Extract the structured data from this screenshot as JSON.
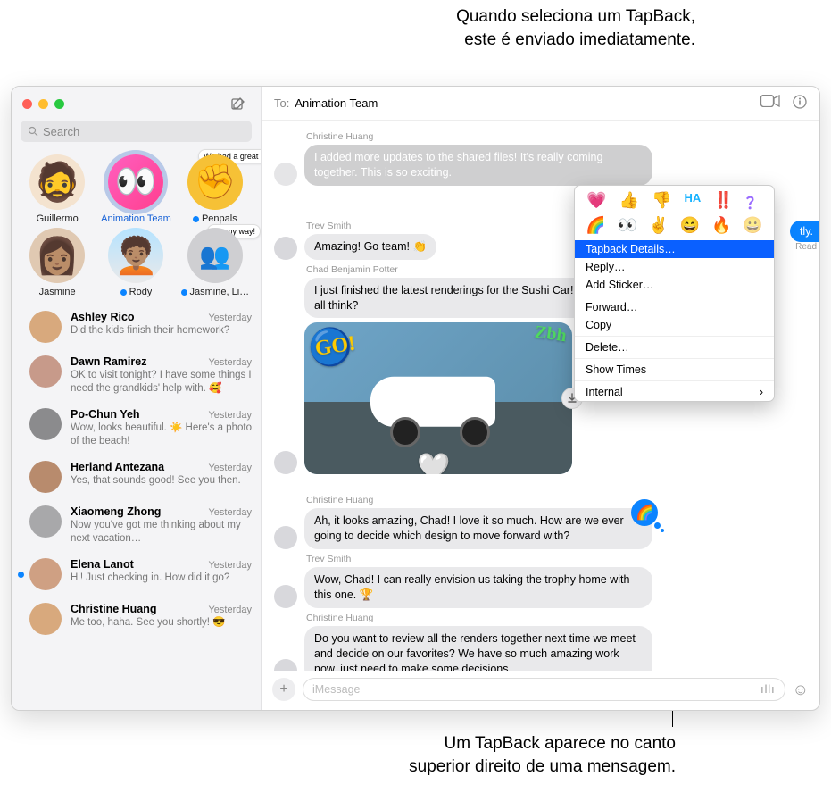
{
  "annotations": {
    "top": "Quando seleciona um TapBack,\neste é enviado imediatamente.",
    "bottom": "Um TapBack aparece no canto\nsuperior direito de uma mensagem."
  },
  "search": {
    "placeholder": "Search"
  },
  "header": {
    "to_label": "To:",
    "to_value": "Animation Team"
  },
  "pins": [
    {
      "name": "Guillermo",
      "selected": false,
      "unread": false,
      "face": "🧔"
    },
    {
      "name": "Animation Team",
      "selected": true,
      "unread": false,
      "face": "👀",
      "bg": "#ff4fa0"
    },
    {
      "name": "Penpals",
      "selected": false,
      "unread": true,
      "face": "✊",
      "preview": "We had a great time. Home with…",
      "bg": "#f6c136"
    },
    {
      "name": "Jasmine",
      "selected": false,
      "unread": false,
      "face": "👩🏽"
    },
    {
      "name": "Rody",
      "selected": false,
      "unread": true,
      "face": "🧑🏽‍🦱",
      "bg": "#e9e9ea"
    },
    {
      "name": "Jasmine, Li…",
      "selected": false,
      "unread": true,
      "face": "👥",
      "preview": "On my way!"
    }
  ],
  "convos": [
    {
      "name": "Ashley Rico",
      "time": "Yesterday",
      "preview": "Did the kids finish their homework?",
      "unread": false,
      "bg": "#d8a97d"
    },
    {
      "name": "Dawn Ramirez",
      "time": "Yesterday",
      "preview": "OK to visit tonight? I have some things I need the grandkids' help with. 🥰",
      "unread": false,
      "bg": "#c79a8a"
    },
    {
      "name": "Po-Chun Yeh",
      "time": "Yesterday",
      "preview": "Wow, looks beautiful. ☀️ Here's a photo of the beach!",
      "unread": false,
      "bg": "#8b8b8d"
    },
    {
      "name": "Herland Antezana",
      "time": "Yesterday",
      "preview": "Yes, that sounds good! See you then.",
      "unread": false,
      "bg": "#b88b6d"
    },
    {
      "name": "Xiaomeng Zhong",
      "time": "Yesterday",
      "preview": "Now you've got me thinking about my next vacation…",
      "unread": false,
      "bg": "#a8a8aa"
    },
    {
      "name": "Elena Lanot",
      "time": "Yesterday",
      "preview": "Hi! Just checking in. How did it go?",
      "unread": true,
      "bg": "#cfa083"
    },
    {
      "name": "Christine Huang",
      "time": "Yesterday",
      "preview": "Me too, haha. See you shortly! 😎",
      "unread": false,
      "bg": "#d8a97d"
    }
  ],
  "messages": {
    "m1_sender": "Christine Huang",
    "m1": "I added more updates to the shared files! It's really coming together. This is so exciting.",
    "m2_sender": "Trev Smith",
    "m2": "Amazing! Go team! 👏",
    "m3_sender": "Chad Benjamin Potter",
    "m3": "I just finished the latest renderings for the Sushi Car! What do you all think?",
    "out_frag": "tly.",
    "read": "Read",
    "m4_sender": "Christine Huang",
    "m4": "Ah, it looks amazing, Chad! I love it so much. How are we ever going to decide which design to move forward with?",
    "m5_sender": "Trev Smith",
    "m5": "Wow, Chad! I can really envision us taking the trophy home with this one. 🏆",
    "m6_sender": "Christine Huang",
    "m6": "Do you want to review all the renders together next time we meet and decide on our favorites? We have so much amazing work now, just need to make some decisions."
  },
  "tapback_row1": [
    "💗",
    "👍",
    "👎",
    "HA",
    "‼️",
    "？"
  ],
  "tapback_row2": [
    "🌈",
    "👀",
    "✌️",
    "😄",
    "🔥",
    "😀"
  ],
  "context": {
    "details": "Tapback Details…",
    "reply": "Reply…",
    "sticker": "Add Sticker…",
    "forward": "Forward…",
    "copy": "Copy",
    "delete": "Delete…",
    "showtimes": "Show Times",
    "internal": "Internal"
  },
  "composer": {
    "placeholder": "iMessage"
  }
}
